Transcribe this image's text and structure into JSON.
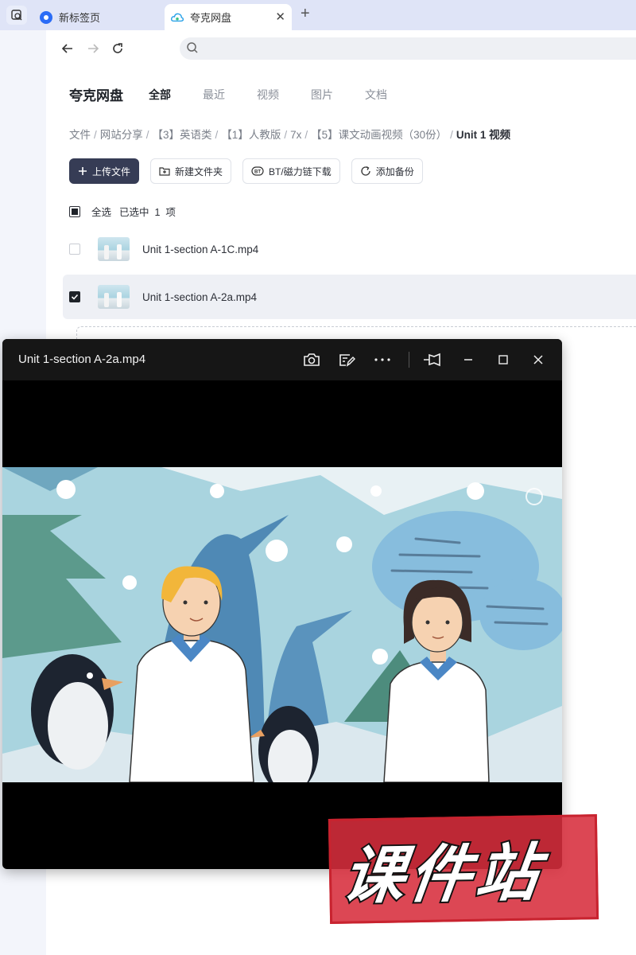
{
  "browser": {
    "tabs": [
      {
        "label": "新标签页",
        "active": false
      },
      {
        "label": "夸克网盘",
        "active": true
      }
    ],
    "new_tab_symbol": "+",
    "close_symbol": "✕",
    "address_value": ""
  },
  "app": {
    "brand": "夸克网盘",
    "categories": [
      "全部",
      "最近",
      "视频",
      "图片",
      "文档"
    ],
    "active_category": "全部",
    "breadcrumb": [
      "文件",
      "网站分享",
      "【3】英语类",
      "【1】人教版",
      "7x",
      "【5】课文动画视频（30份）"
    ],
    "breadcrumb_current": "Unit 1 视频",
    "breadcrumb_separator": "/",
    "actions": {
      "upload": "上传文件",
      "new_folder": "新建文件夹",
      "bt_download": "BT/磁力链下载",
      "add_backup": "添加备份"
    },
    "selection": {
      "select_all": "全选",
      "status": "已选中  1  项"
    },
    "files": [
      {
        "name": "Unit 1-section A-1C.mp4",
        "checked": false
      },
      {
        "name": "Unit 1-section A-2a.mp4",
        "checked": true
      }
    ]
  },
  "player": {
    "title": "Unit 1-section A-2a.mp4",
    "controls": [
      "camera-icon",
      "edit-icon",
      "more-icon",
      "pin-icon",
      "minimize-icon",
      "maximize-icon",
      "close-icon"
    ]
  },
  "watermark": {
    "text": "课件站"
  },
  "colors": {
    "tabbar_bg": "#dfe4f7",
    "primary_button": "#363c55",
    "stamp_red": "#d72d3c",
    "player_bg": "#000000"
  }
}
